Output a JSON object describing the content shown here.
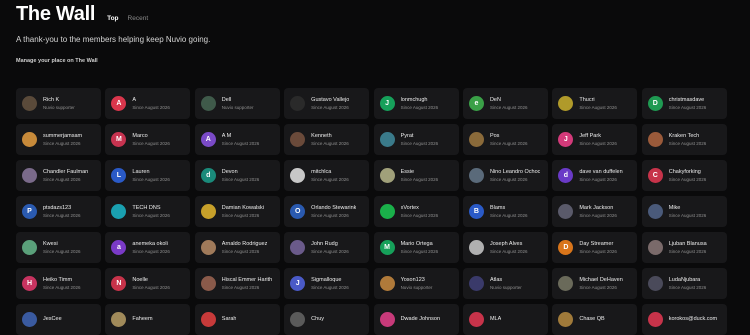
{
  "header": {
    "title": "The Wall",
    "tabs": [
      {
        "label": "Top",
        "active": true
      },
      {
        "label": "Recent",
        "active": false
      }
    ]
  },
  "subtitle": "A thank-you to the members helping keep Nuvio going.",
  "manage_link": "Manage your place on The Wall",
  "colors": {
    "background": "#0a0a0b",
    "card": "#18181a",
    "muted_text": "#8f8f8f"
  },
  "members": [
    {
      "name": "Rich K",
      "since": "Nuvio supporter",
      "initial": "",
      "avatar_color": "#5a4a3a",
      "photo": true
    },
    {
      "name": "A",
      "since": "Since August 2026",
      "initial": "A",
      "avatar_color": "#d9364c",
      "photo": false
    },
    {
      "name": "Dell",
      "since": "Nuvio supporter",
      "initial": "",
      "avatar_color": "#3f5a4a",
      "photo": true
    },
    {
      "name": "Gustavo Vallejo",
      "since": "Since August 2026",
      "initial": "",
      "avatar_color": "#2a2a2a",
      "photo": true
    },
    {
      "name": "lonmchugh",
      "since": "Since August 2026",
      "initial": "J",
      "avatar_color": "#16a05a",
      "photo": false
    },
    {
      "name": "DeN",
      "since": "Since August 2026",
      "initial": "e",
      "avatar_color": "#3aa047",
      "photo": false
    },
    {
      "name": "Thucri",
      "since": "Since August 2026",
      "initial": "",
      "avatar_color": "#b09a2a",
      "photo": true
    },
    {
      "name": "christmasdave",
      "since": "Since August 2026",
      "initial": "D",
      "avatar_color": "#1f9a52",
      "photo": false
    },
    {
      "name": "summerjamsam",
      "since": "Since August 2026",
      "initial": "",
      "avatar_color": "#c78a3a",
      "photo": true
    },
    {
      "name": "Marco",
      "since": "Since August 2026",
      "initial": "M",
      "avatar_color": "#c73350",
      "photo": false
    },
    {
      "name": "A M",
      "since": "Since August 2026",
      "initial": "A",
      "avatar_color": "#7a4ac7",
      "photo": false
    },
    {
      "name": "Kenneth",
      "since": "Since August 2026",
      "initial": "",
      "avatar_color": "#6a4a3a",
      "photo": true
    },
    {
      "name": "Pyrat",
      "since": "Since August 2026",
      "initial": "",
      "avatar_color": "#3a7a8a",
      "photo": true
    },
    {
      "name": "Pos",
      "since": "Since August 2026",
      "initial": "",
      "avatar_color": "#8a6a3a",
      "photo": true
    },
    {
      "name": "Jeff Park",
      "since": "Since August 2026",
      "initial": "J",
      "avatar_color": "#d33a7a",
      "photo": false
    },
    {
      "name": "Kraken Tech",
      "since": "Since August 2026",
      "initial": "",
      "avatar_color": "#9a5a3a",
      "photo": true
    },
    {
      "name": "Chandler Faulman",
      "since": "Since August 2026",
      "initial": "",
      "avatar_color": "#7a6a8a",
      "photo": true
    },
    {
      "name": "Lauren",
      "since": "Since August 2026",
      "initial": "L",
      "avatar_color": "#2a5ac7",
      "photo": false
    },
    {
      "name": "Devon",
      "since": "Since August 2026",
      "initial": "d",
      "avatar_color": "#1a8a7a",
      "photo": false
    },
    {
      "name": "mitchlca",
      "since": "Since August 2026",
      "initial": "",
      "avatar_color": "#c7c7c7",
      "photo": true
    },
    {
      "name": "Essie",
      "since": "Since August 2026",
      "initial": "",
      "avatar_color": "#a0a07a",
      "photo": true
    },
    {
      "name": "Nino Leandro Ochoc",
      "since": "Since August 2026",
      "initial": "",
      "avatar_color": "#5a6a7a",
      "photo": true
    },
    {
      "name": "dave van duffelen",
      "since": "Since August 2026",
      "initial": "d",
      "avatar_color": "#6a3ac7",
      "photo": false
    },
    {
      "name": "Chakyforking",
      "since": "Since August 2026",
      "initial": "C",
      "avatar_color": "#c7334a",
      "photo": false
    },
    {
      "name": "ptsdazs123",
      "since": "Since August 2026",
      "initial": "P",
      "avatar_color": "#2a5ab0",
      "photo": false
    },
    {
      "name": "TECH DNS",
      "since": "Since August 2026",
      "initial": "",
      "avatar_color": "#1aa0b0",
      "photo": true
    },
    {
      "name": "Damian Kowalski",
      "since": "Since August 2026",
      "initial": "",
      "avatar_color": "#c7a02a",
      "photo": true
    },
    {
      "name": "Orlando Stewarink",
      "since": "Since August 2026",
      "initial": "O",
      "avatar_color": "#2a5ab0",
      "photo": false
    },
    {
      "name": "xVortex",
      "since": "Since August 2026",
      "initial": "",
      "avatar_color": "#1ab04a",
      "photo": true
    },
    {
      "name": "Blams",
      "since": "Since August 2026",
      "initial": "B",
      "avatar_color": "#2a5ac7",
      "photo": false
    },
    {
      "name": "Mark Jackson",
      "since": "Since August 2026",
      "initial": "",
      "avatar_color": "#5a5a6a",
      "photo": true
    },
    {
      "name": "Mike",
      "since": "Since August 2026",
      "initial": "",
      "avatar_color": "#4a5a7a",
      "photo": true
    },
    {
      "name": "Kwesi",
      "since": "Since August 2026",
      "initial": "",
      "avatar_color": "#5aa07a",
      "photo": true
    },
    {
      "name": "anemeka okoli",
      "since": "Since August 2026",
      "initial": "a",
      "avatar_color": "#7a3ac7",
      "photo": false
    },
    {
      "name": "Arnaldo Rodriguez",
      "since": "Since August 2026",
      "initial": "",
      "avatar_color": "#a07a5a",
      "photo": true
    },
    {
      "name": "John Rudg",
      "since": "Since August 2026",
      "initial": "",
      "avatar_color": "#6a5a8a",
      "photo": true
    },
    {
      "name": "Mario Ortega",
      "since": "Since August 2026",
      "initial": "M",
      "avatar_color": "#16a05a",
      "photo": false
    },
    {
      "name": "Joseph Alves",
      "since": "Since August 2026",
      "initial": "",
      "avatar_color": "#b0b0b0",
      "photo": true
    },
    {
      "name": "Day Streamer",
      "since": "Since August 2026",
      "initial": "D",
      "avatar_color": "#d9751a",
      "photo": false
    },
    {
      "name": "Ljuban Blanusa",
      "since": "Since August 2026",
      "initial": "",
      "avatar_color": "#7a6a6a",
      "photo": true
    },
    {
      "name": "Heiko Timm",
      "since": "Since August 2026",
      "initial": "H",
      "avatar_color": "#c73360",
      "photo": false
    },
    {
      "name": "Noelle",
      "since": "Since August 2026",
      "initial": "N",
      "avatar_color": "#c7334a",
      "photo": false
    },
    {
      "name": "Hiscal Emmer Harith",
      "since": "Since August 2026",
      "initial": "",
      "avatar_color": "#8a5a4a",
      "photo": true
    },
    {
      "name": "Sigmalloque",
      "since": "Since August 2026",
      "initial": "J",
      "avatar_color": "#4a5ac7",
      "photo": false
    },
    {
      "name": "Yoson123",
      "since": "Nuvio supporter",
      "initial": "",
      "avatar_color": "#b07a3a",
      "photo": true
    },
    {
      "name": "Atlas",
      "since": "Nuvio supporter",
      "initial": "",
      "avatar_color": "#3a3a6a",
      "photo": true
    },
    {
      "name": "Michael DeHaven",
      "since": "Since August 2026",
      "initial": "",
      "avatar_color": "#6a6a5a",
      "photo": true
    },
    {
      "name": "LudaNjubara",
      "since": "Since August 2026",
      "initial": "",
      "avatar_color": "#4a4a5a",
      "photo": true
    },
    {
      "name": "JesCee",
      "since": "",
      "initial": "",
      "avatar_color": "#3a5aa0",
      "photo": true
    },
    {
      "name": "Faheem",
      "since": "",
      "initial": "",
      "avatar_color": "#a08a5a",
      "photo": true
    },
    {
      "name": "Sarah",
      "since": "",
      "initial": "",
      "avatar_color": "#c73a3a",
      "photo": true
    },
    {
      "name": "Chuy",
      "since": "",
      "initial": "",
      "avatar_color": "#5a5a5a",
      "photo": true
    },
    {
      "name": "Dwade Johnson",
      "since": "",
      "initial": "",
      "avatar_color": "#c73a7a",
      "photo": true
    },
    {
      "name": "MLA",
      "since": "",
      "initial": "",
      "avatar_color": "#c7334a",
      "photo": true
    },
    {
      "name": "Chase QB",
      "since": "",
      "initial": "",
      "avatar_color": "#a07a3a",
      "photo": true
    },
    {
      "name": "korokos@duck.com",
      "since": "",
      "initial": "",
      "avatar_color": "#c7334a",
      "photo": true
    }
  ]
}
